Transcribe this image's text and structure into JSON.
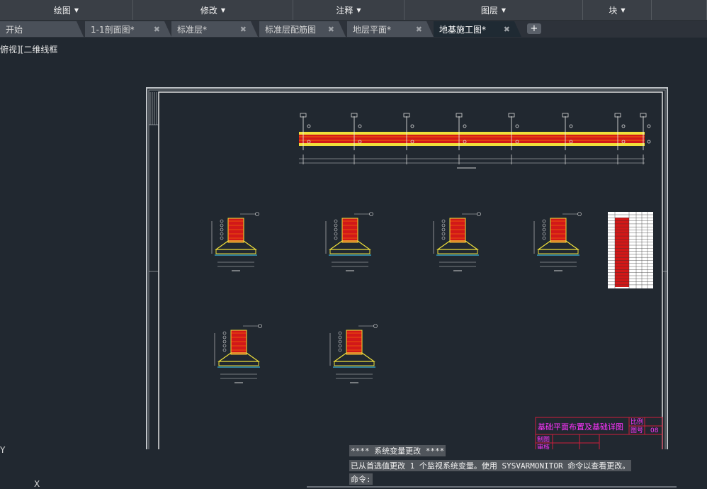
{
  "ribbon": {
    "groups": [
      {
        "label": "绘图",
        "width": 188
      },
      {
        "label": "修改",
        "width": 226
      },
      {
        "label": "注释",
        "width": 157
      },
      {
        "label": "图层",
        "width": 252
      },
      {
        "label": "块",
        "width": 97
      },
      {
        "label": "",
        "width": 78
      }
    ]
  },
  "tabs": [
    {
      "label": "开始"
    },
    {
      "label": "1-1剖面图*"
    },
    {
      "label": "标准层*"
    },
    {
      "label": "标准层配筋图"
    },
    {
      "label": "地层平面*"
    },
    {
      "label": "地基施工图*"
    }
  ],
  "view_label": "俯视][二维线框",
  "title_block": {
    "title": "基础平面布置及基础详图",
    "scale_label": "比例",
    "sheet_label": "图号",
    "sheet_no": "08",
    "drawn_label": "制图",
    "checked_label": "审核"
  },
  "command": {
    "line1": "**** 系统变量更改 ****",
    "line2": "已从首选值更改 1 个监视系统变量。使用 SYSVARMONITOR 命令以查看更改。",
    "prompt": "命令:"
  },
  "ucs": {
    "y": "Y",
    "x": "X"
  },
  "colors": {
    "canvas": "#212830",
    "footing_red": "#e21b1b",
    "footing_yellow": "#f0e03a",
    "title_magenta": "#ff33ff"
  }
}
